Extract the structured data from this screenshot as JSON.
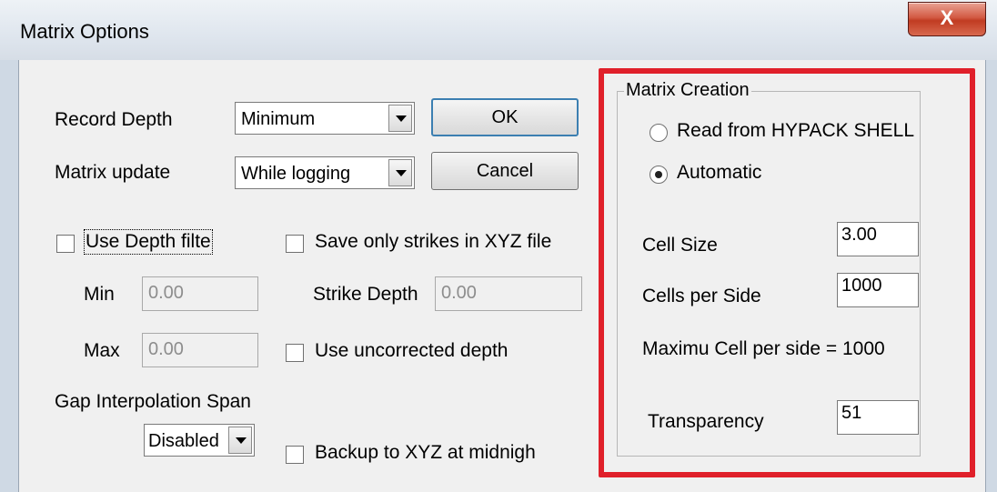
{
  "window": {
    "title": "Matrix Options",
    "close_label": "X"
  },
  "left": {
    "record_depth_label": "Record Depth",
    "record_depth_value": "Minimum",
    "matrix_update_label": "Matrix update",
    "matrix_update_value": "While logging",
    "use_depth_filter_label": "Use Depth filte",
    "use_depth_filter_checked": false,
    "min_label": "Min",
    "min_value": "0.00",
    "max_label": "Max",
    "max_value": "0.00",
    "gap_label": "Gap Interpolation Span",
    "gap_value": "Disabled"
  },
  "middle": {
    "ok_label": "OK",
    "cancel_label": "Cancel",
    "save_strikes_label": "Save only strikes in XYZ file",
    "strike_depth_label": "Strike Depth",
    "strike_depth_value": "0.00",
    "use_uncorrected_label": "Use uncorrected depth",
    "backup_label": "Backup to XYZ at midnigh"
  },
  "matrix_creation": {
    "group_title": "Matrix Creation",
    "radio_read_label": "Read from HYPACK SHELL",
    "radio_auto_label": "Automatic",
    "selected": "Automatic",
    "cell_size_label": "Cell Size",
    "cell_size_value": "3.00",
    "cells_per_side_label": "Cells per Side",
    "cells_per_side_value": "1000",
    "max_info": "Maximu Cell per side = 1000",
    "transparency_label": "Transparency",
    "transparency_value": "51"
  },
  "colors": {
    "highlight": "#e0202a",
    "panel": "#f0f0f0"
  }
}
